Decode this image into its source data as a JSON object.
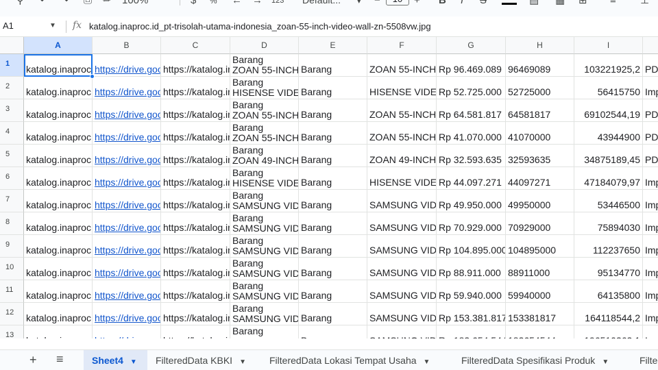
{
  "toolbar": {
    "zoom": "100%",
    "font": "Default...",
    "font_size": "10",
    "percent_label": "%",
    "number_format": ".00",
    "format_123": "123"
  },
  "formula_bar": {
    "cell_ref": "A1",
    "fx": "fx",
    "content": "katalog.inaproc.id_pt-trisolah-utama-indonesia_zoan-55-inch-video-wall-zn-5508vw.jpg"
  },
  "grid": {
    "columns": [
      "A",
      "B",
      "C",
      "D",
      "E",
      "F",
      "G",
      "H",
      "I"
    ],
    "rows": [
      {
        "n": "1",
        "a": "katalog.inaproc.i",
        "b": "https://drive.goo",
        "c": "https://katalog.in",
        "d1": "Barang",
        "d2": "ZOAN 55-INCH",
        "e": "Barang",
        "f": "ZOAN 55-INCH",
        "g": "Rp 96.469.089",
        "h": "96469089",
        "i": "103221925,2",
        "j": "PD"
      },
      {
        "n": "2",
        "a": "katalog.inaproc.i",
        "b": "https://drive.goo",
        "c": "https://katalog.in",
        "d1": "Barang",
        "d2": "HISENSE VIDEO",
        "e": "Barang",
        "f": "HISENSE VIDEO",
        "g": "Rp 52.725.000",
        "h": "52725000",
        "i": "56415750",
        "j": "Imp"
      },
      {
        "n": "3",
        "a": "katalog.inaproc.i",
        "b": "https://drive.goo",
        "c": "https://katalog.in",
        "d1": "Barang",
        "d2": "ZOAN 55-INCH",
        "e": "Barang",
        "f": "ZOAN 55-INCH",
        "g": "Rp 64.581.817",
        "h": "64581817",
        "i": "69102544,19",
        "j": "PD"
      },
      {
        "n": "4",
        "a": "katalog.inaproc.i",
        "b": "https://drive.goo",
        "c": "https://katalog.in",
        "d1": "Barang",
        "d2": "ZOAN 55-INCH",
        "e": "Barang",
        "f": "ZOAN 55-INCH",
        "g": "Rp 41.070.000",
        "h": "41070000",
        "i": "43944900",
        "j": "PD"
      },
      {
        "n": "5",
        "a": "katalog.inaproc.i",
        "b": "https://drive.goo",
        "c": "https://katalog.in",
        "d1": "Barang",
        "d2": "ZOAN 49-INCH",
        "e": "Barang",
        "f": "ZOAN 49-INCH",
        "g": "Rp 32.593.635",
        "h": "32593635",
        "i": "34875189,45",
        "j": "PD"
      },
      {
        "n": "6",
        "a": "katalog.inaproc.i",
        "b": "https://drive.goo",
        "c": "https://katalog.in",
        "d1": "Barang",
        "d2": "HISENSE VIDEO",
        "e": "Barang",
        "f": "HISENSE VIDEO",
        "g": "Rp 44.097.271",
        "h": "44097271",
        "i": "47184079,97",
        "j": "Imp"
      },
      {
        "n": "7",
        "a": "katalog.inaproc.i",
        "b": "https://drive.goo",
        "c": "https://katalog.in",
        "d1": "Barang",
        "d2": "SAMSUNG VIDE",
        "e": "Barang",
        "f": "SAMSUNG VIDE",
        "g": "Rp 49.950.000",
        "h": "49950000",
        "i": "53446500",
        "j": "Imp"
      },
      {
        "n": "8",
        "a": "katalog.inaproc.i",
        "b": "https://drive.goo",
        "c": "https://katalog.in",
        "d1": "Barang",
        "d2": "SAMSUNG VIDE",
        "e": "Barang",
        "f": "SAMSUNG VIDE",
        "g": "Rp 70.929.000",
        "h": "70929000",
        "i": "75894030",
        "j": "Imp"
      },
      {
        "n": "9",
        "a": "katalog.inaproc.i",
        "b": "https://drive.goo",
        "c": "https://katalog.in",
        "d1": "Barang",
        "d2": "SAMSUNG VIDE",
        "e": "Barang",
        "f": "SAMSUNG VIDE",
        "g": "Rp 104.895.000",
        "h": "104895000",
        "i": "112237650",
        "j": "Imp"
      },
      {
        "n": "10",
        "a": "katalog.inaproc.i",
        "b": "https://drive.goo",
        "c": "https://katalog.in",
        "d1": "Barang",
        "d2": "SAMSUNG VIDE",
        "e": "Barang",
        "f": "SAMSUNG VIDE",
        "g": "Rp 88.911.000",
        "h": "88911000",
        "i": "95134770",
        "j": "Imp"
      },
      {
        "n": "11",
        "a": "katalog.inaproc.i",
        "b": "https://drive.goo",
        "c": "https://katalog.in",
        "d1": "Barang",
        "d2": "SAMSUNG VIDE",
        "e": "Barang",
        "f": "SAMSUNG VIDE",
        "g": "Rp 59.940.000",
        "h": "59940000",
        "i": "64135800",
        "j": "Imp"
      },
      {
        "n": "12",
        "a": "katalog.inaproc.i",
        "b": "https://drive.goo",
        "c": "https://katalog.in",
        "d1": "Barang",
        "d2": "SAMSUNG VIDE",
        "e": "Barang",
        "f": "SAMSUNG VIDE",
        "g": "Rp 153.381.817",
        "h": "153381817",
        "i": "164118544,2",
        "j": "Imp"
      },
      {
        "n": "13",
        "a": "katalog.inaproc.i",
        "b": "https://drive.goo",
        "c": "https://katalog.in",
        "d1": "Barang",
        "d2": "",
        "e": "Barang",
        "f": "SAMSUNG VIDE",
        "g": "Rp 183.654.544",
        "h": "183654544",
        "i": "196510362,1",
        "j": "Imp"
      }
    ]
  },
  "sheet_tabs": {
    "active": "Sheet4",
    "tabs": [
      "Sheet4",
      "FilteredData KBKI",
      "FilteredData Lokasi Tempat Usaha",
      "FilteredData Spesifikasi Produk",
      "Filte"
    ]
  }
}
